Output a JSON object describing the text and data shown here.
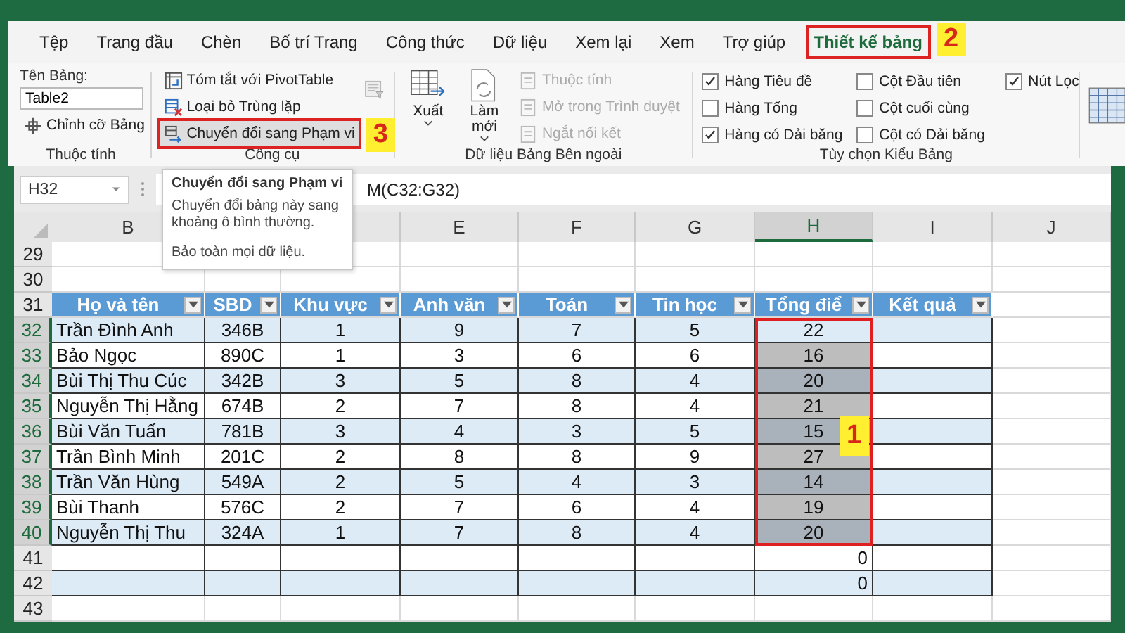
{
  "tabs": [
    {
      "label": "Tệp",
      "selected": false
    },
    {
      "label": "Trang đầu",
      "selected": false
    },
    {
      "label": "Chèn",
      "selected": false
    },
    {
      "label": "Bố trí Trang",
      "selected": false
    },
    {
      "label": "Công thức",
      "selected": false
    },
    {
      "label": "Dữ liệu",
      "selected": false
    },
    {
      "label": "Xem lại",
      "selected": false
    },
    {
      "label": "Xem",
      "selected": false
    },
    {
      "label": "Trợ giúp",
      "selected": false
    },
    {
      "label": "Thiết kế bảng",
      "selected": true,
      "callout": "2"
    }
  ],
  "ribbon": {
    "properties": {
      "title": "Thuộc tính",
      "name_label": "Tên Bảng:",
      "name_value": "Table2",
      "resize_label": "Chỉnh cỡ Bảng"
    },
    "tools": {
      "title": "Công cụ",
      "items": [
        {
          "label": "Tóm tắt với PivotTable"
        },
        {
          "label": "Loại bỏ Trùng lặp"
        },
        {
          "label": "Chuyển đổi sang Phạm vi",
          "callout": "3"
        }
      ]
    },
    "external": {
      "title": "Dữ liệu Bảng Bên ngoài",
      "big": [
        {
          "label": "Xuất"
        },
        {
          "label": "Làm mới"
        }
      ],
      "small": [
        {
          "label": "Thuộc tính",
          "disabled": true
        },
        {
          "label": "Mở trong Trình duyệt",
          "disabled": true
        },
        {
          "label": "Ngắt nối kết",
          "disabled": true
        }
      ]
    },
    "style_options": {
      "title": "Tùy chọn Kiểu Bảng",
      "items": [
        {
          "label": "Hàng Tiêu đề",
          "checked": true
        },
        {
          "label": "Hàng Tổng",
          "checked": false
        },
        {
          "label": "Hàng có Dải băng",
          "checked": true
        },
        {
          "label": "Cột Đầu tiên",
          "checked": false
        },
        {
          "label": "Cột cuối cùng",
          "checked": false
        },
        {
          "label": "Cột có Dải băng",
          "checked": false
        },
        {
          "label": "Nút Lọc",
          "checked": true
        }
      ]
    }
  },
  "formula_bar": {
    "name_box": "H32",
    "formula": "M(C32:G32)"
  },
  "tooltip": {
    "title": "Chuyển đổi sang Phạm vi",
    "body": "Chuyển đổi bảng này sang khoảng ô bình thường.",
    "note": "Bảo toàn mọi dữ liệu."
  },
  "sheet": {
    "columns": [
      {
        "letter": "B",
        "selected": false
      },
      {},
      {},
      {
        "letter": "E",
        "selected": false
      },
      {
        "letter": "F",
        "selected": false
      },
      {
        "letter": "G",
        "selected": false
      },
      {
        "letter": "H",
        "selected": true,
        "callout": "1"
      },
      {
        "letter": "I",
        "selected": false
      },
      {
        "letter": "J",
        "selected": false
      }
    ],
    "table_headers": [
      "Họ và tên",
      "SBD",
      "Khu vực",
      "Anh văn",
      "Toán",
      "Tin học",
      "Tổng điể",
      "Kết quả"
    ],
    "rows": [
      {
        "number": "29",
        "kind": "empty",
        "selected": false
      },
      {
        "number": "30",
        "kind": "empty",
        "selected": false
      },
      {
        "number": "31",
        "kind": "header",
        "selected": false
      },
      {
        "number": "32",
        "kind": "data",
        "selected": true,
        "active": true,
        "cells": [
          "Trần Đình Anh",
          "346B",
          "1",
          "9",
          "7",
          "5",
          "22",
          null
        ]
      },
      {
        "number": "33",
        "kind": "data",
        "selected": true,
        "active": false,
        "cells": [
          "Bảo Ngọc",
          "890C",
          "1",
          "3",
          "6",
          "6",
          "16",
          null
        ]
      },
      {
        "number": "34",
        "kind": "data",
        "selected": true,
        "active": false,
        "cells": [
          "Bùi Thị Thu Cúc",
          "342B",
          "3",
          "5",
          "8",
          "4",
          "20",
          null
        ]
      },
      {
        "number": "35",
        "kind": "data",
        "selected": true,
        "active": false,
        "cells": [
          "Nguyễn Thị Hằng",
          "674B",
          "2",
          "7",
          "8",
          "4",
          "21",
          null
        ]
      },
      {
        "number": "36",
        "kind": "data",
        "selected": true,
        "active": false,
        "cells": [
          "Bùi Văn Tuấn",
          "781B",
          "3",
          "4",
          "3",
          "5",
          "15",
          null
        ]
      },
      {
        "number": "37",
        "kind": "data",
        "selected": true,
        "active": false,
        "cells": [
          "Trần Bình Minh",
          "201C",
          "2",
          "8",
          "8",
          "9",
          "27",
          null
        ]
      },
      {
        "number": "38",
        "kind": "data",
        "selected": true,
        "active": false,
        "cells": [
          "Trần Văn Hùng",
          "549A",
          "2",
          "5",
          "4",
          "3",
          "14",
          null
        ]
      },
      {
        "number": "39",
        "kind": "data",
        "selected": true,
        "active": false,
        "cells": [
          "Bùi Thanh",
          "576C",
          "2",
          "7",
          "6",
          "4",
          "19",
          null
        ]
      },
      {
        "number": "40",
        "kind": "data",
        "selected": true,
        "active": false,
        "cells": [
          "Nguyễn Thị Thu",
          "324A",
          "1",
          "7",
          "8",
          "4",
          "20",
          null
        ]
      },
      {
        "number": "41",
        "kind": "tail",
        "selected": false,
        "cells": [
          null,
          null,
          null,
          null,
          null,
          null,
          "0",
          null
        ]
      },
      {
        "number": "42",
        "kind": "tail",
        "selected": false,
        "cells": [
          null,
          null,
          null,
          null,
          null,
          null,
          "0",
          null
        ]
      },
      {
        "number": "43",
        "kind": "empty",
        "selected": false
      }
    ]
  }
}
